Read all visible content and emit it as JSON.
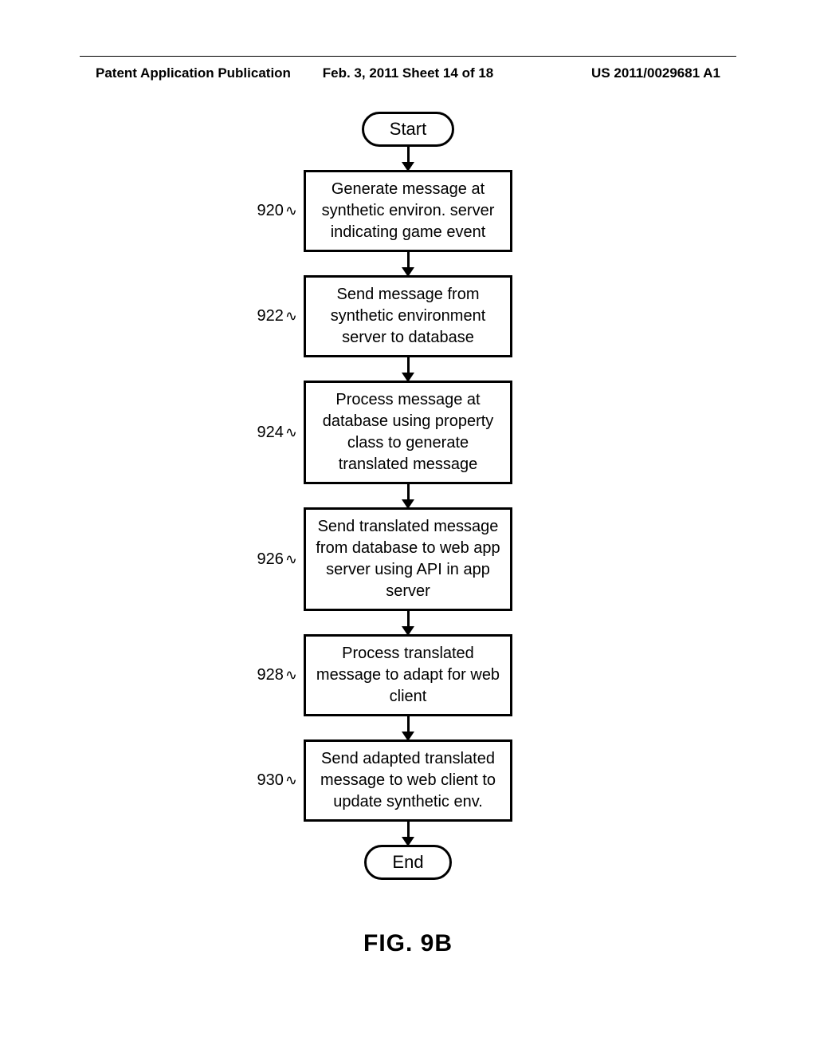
{
  "header": {
    "left": "Patent Application Publication",
    "center": "Feb. 3, 2011   Sheet 14 of 18",
    "right": "US 2011/0029681 A1"
  },
  "flowchart": {
    "start": "Start",
    "end": "End",
    "steps": [
      {
        "label": "920",
        "text": "Generate message at synthetic environ. server indicating game event"
      },
      {
        "label": "922",
        "text": "Send message from synthetic environment server to database"
      },
      {
        "label": "924",
        "text": "Process message at database using property class to generate translated message"
      },
      {
        "label": "926",
        "text": "Send translated message from database to web app server using API in app server"
      },
      {
        "label": "928",
        "text": "Process translated message to adapt for web client"
      },
      {
        "label": "930",
        "text": "Send adapted translated message to web client to update synthetic env."
      }
    ]
  },
  "figure_label": "FIG. 9B"
}
